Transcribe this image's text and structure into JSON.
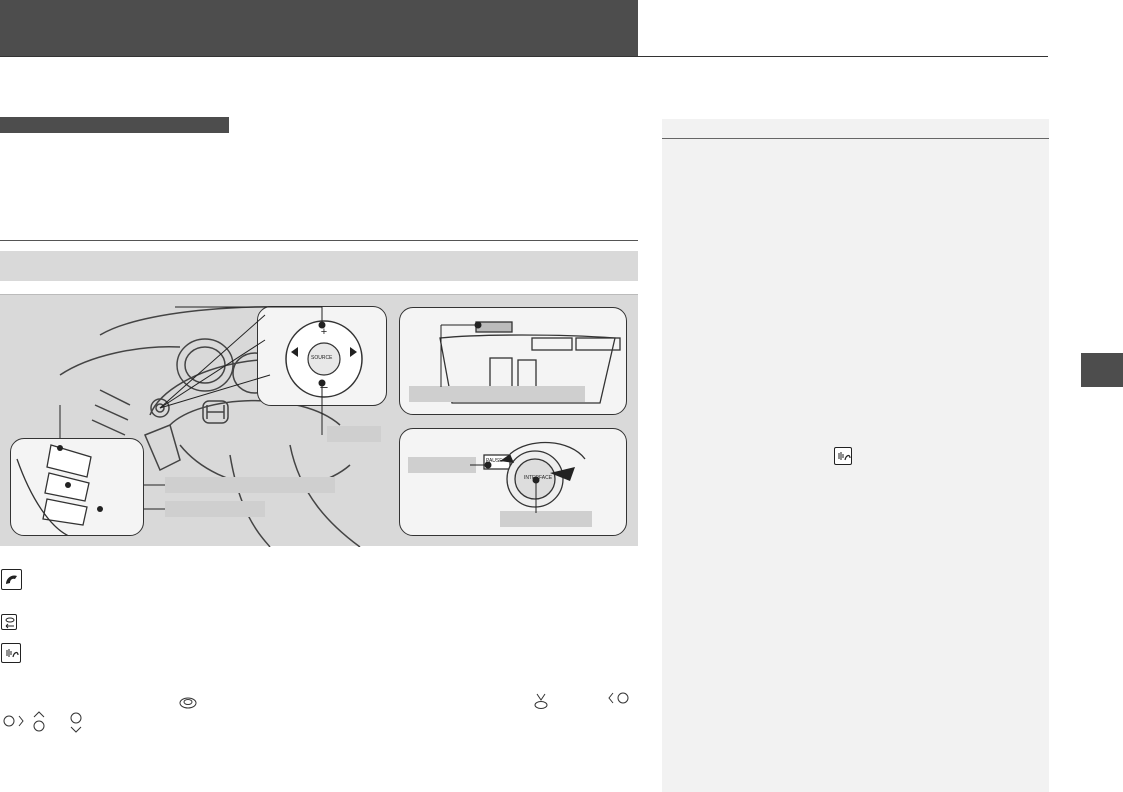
{
  "header": {
    "title": "",
    "section": ""
  },
  "figure": {
    "panels": {
      "pause_button_label": "PAUSE",
      "interface_dial_label": "INTERFACE",
      "source_label": "SOURCE"
    }
  },
  "controls": {
    "pick_up_icon": "phone-pickup-icon",
    "hang_up_back_icon": "hang-up-back-icon",
    "talk_icon": "talk-icon",
    "dial_icons": [
      "interface-dial-icon",
      "enter-dial-icon",
      "left-arrow-dial-icon",
      "right-arrow-dial-icon",
      "up-arrow-dial-icon",
      "down-arrow-dial-icon"
    ]
  },
  "sidebar": {
    "talk_icon": "talk-icon"
  },
  "colors": {
    "dark_bar": "#4d4d4d",
    "light_bar": "#d9d9d9",
    "sidebar_bg": "#f2f2f2"
  }
}
